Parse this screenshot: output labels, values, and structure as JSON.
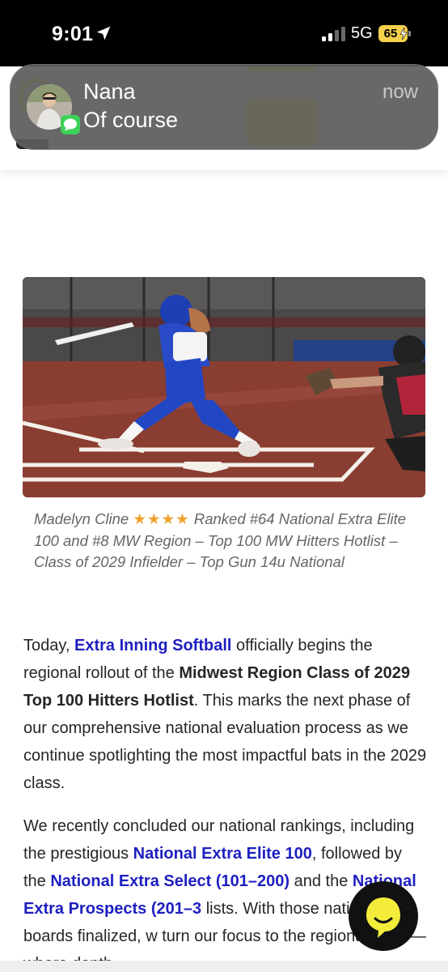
{
  "status_bar": {
    "time": "9:01",
    "network": "5G",
    "battery": "65"
  },
  "notification": {
    "sender": "Nana",
    "message": "Of course",
    "time": "now"
  },
  "article": {
    "caption": {
      "name": "Madelyn Cline",
      "stars": "★★★★",
      "text": "Ranked #64 National Extra Elite 100 and #8 MW Region – Top 100 MW Hitters Hotlist – Class of 2029 Infielder – Top Gun 14u National"
    },
    "paragraph1": {
      "t1": "Today, ",
      "link1": "Extra Inning Softball",
      "t2": " officially begins the regional rollout of the ",
      "bold1": "Midwest Region Class of 2029 Top 100 Hitters Hotlist",
      "t3": ". This marks the next phase of our comprehensive national evaluation process as we continue spotlighting the most impactful bats in the 2029 class."
    },
    "paragraph2": {
      "t1": "We recently concluded our national rankings, including the prestigious ",
      "link1": "National Extra Elite 100",
      "t2": ", followed by the ",
      "link2": "National Extra Select (101–200)",
      "t3": " and the ",
      "link3": "National Extra Prospects (201–3",
      "t4": " lists. With those national boards finalized, w turn our focus to the regional level — where depth"
    }
  },
  "colors": {
    "link": "#1d1fbf",
    "accent_yellow": "#f6ef3c",
    "star": "#f0a12c"
  }
}
